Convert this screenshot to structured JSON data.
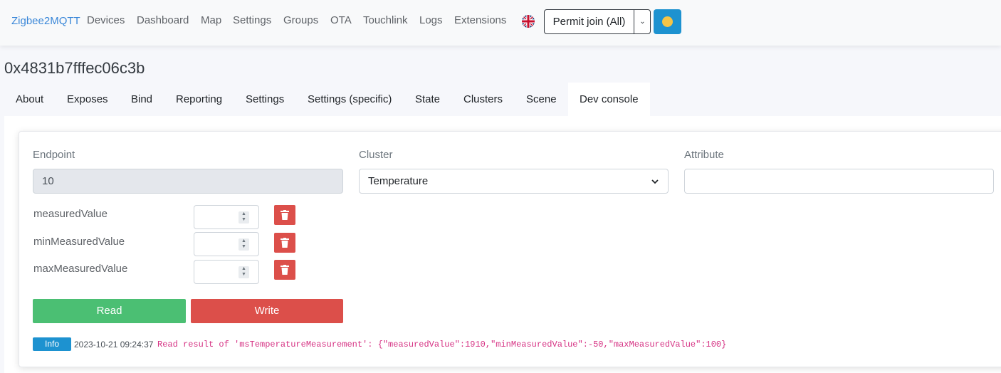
{
  "navbar": {
    "brand": "Zigbee2MQTT",
    "items": [
      "Devices",
      "Dashboard",
      "Map",
      "Settings",
      "Groups",
      "OTA",
      "Touchlink",
      "Logs",
      "Extensions"
    ],
    "language_icon": "uk-flag-icon",
    "permit_join_label": "Permit join (All)",
    "theme_icon": "smiley-icon"
  },
  "device": {
    "title": "0x4831b7fffec06c3b"
  },
  "tabs": [
    "About",
    "Exposes",
    "Bind",
    "Reporting",
    "Settings",
    "Settings (specific)",
    "State",
    "Clusters",
    "Scene",
    "Dev console"
  ],
  "active_tab": "Dev console",
  "form": {
    "endpoint_label": "Endpoint",
    "endpoint_value": "10",
    "cluster_label": "Cluster",
    "cluster_value": "Temperature",
    "attribute_label": "Attribute",
    "attribute_value": ""
  },
  "attributes": [
    {
      "name": "measuredValue",
      "value": ""
    },
    {
      "name": "minMeasuredValue",
      "value": ""
    },
    {
      "name": "maxMeasuredValue",
      "value": ""
    }
  ],
  "buttons": {
    "read": "Read",
    "write": "Write"
  },
  "log": {
    "level": "Info",
    "timestamp": "2023-10-21 09:24:37",
    "message": "Read result of 'msTemperatureMeasurement': {\"measuredValue\":1910,\"minMeasuredValue\":-50,\"maxMeasuredValue\":100}"
  },
  "colors": {
    "primary": "#1d92d0",
    "success": "#4bbf73",
    "danger": "#dc4f4a",
    "brand": "#3a87d8"
  }
}
